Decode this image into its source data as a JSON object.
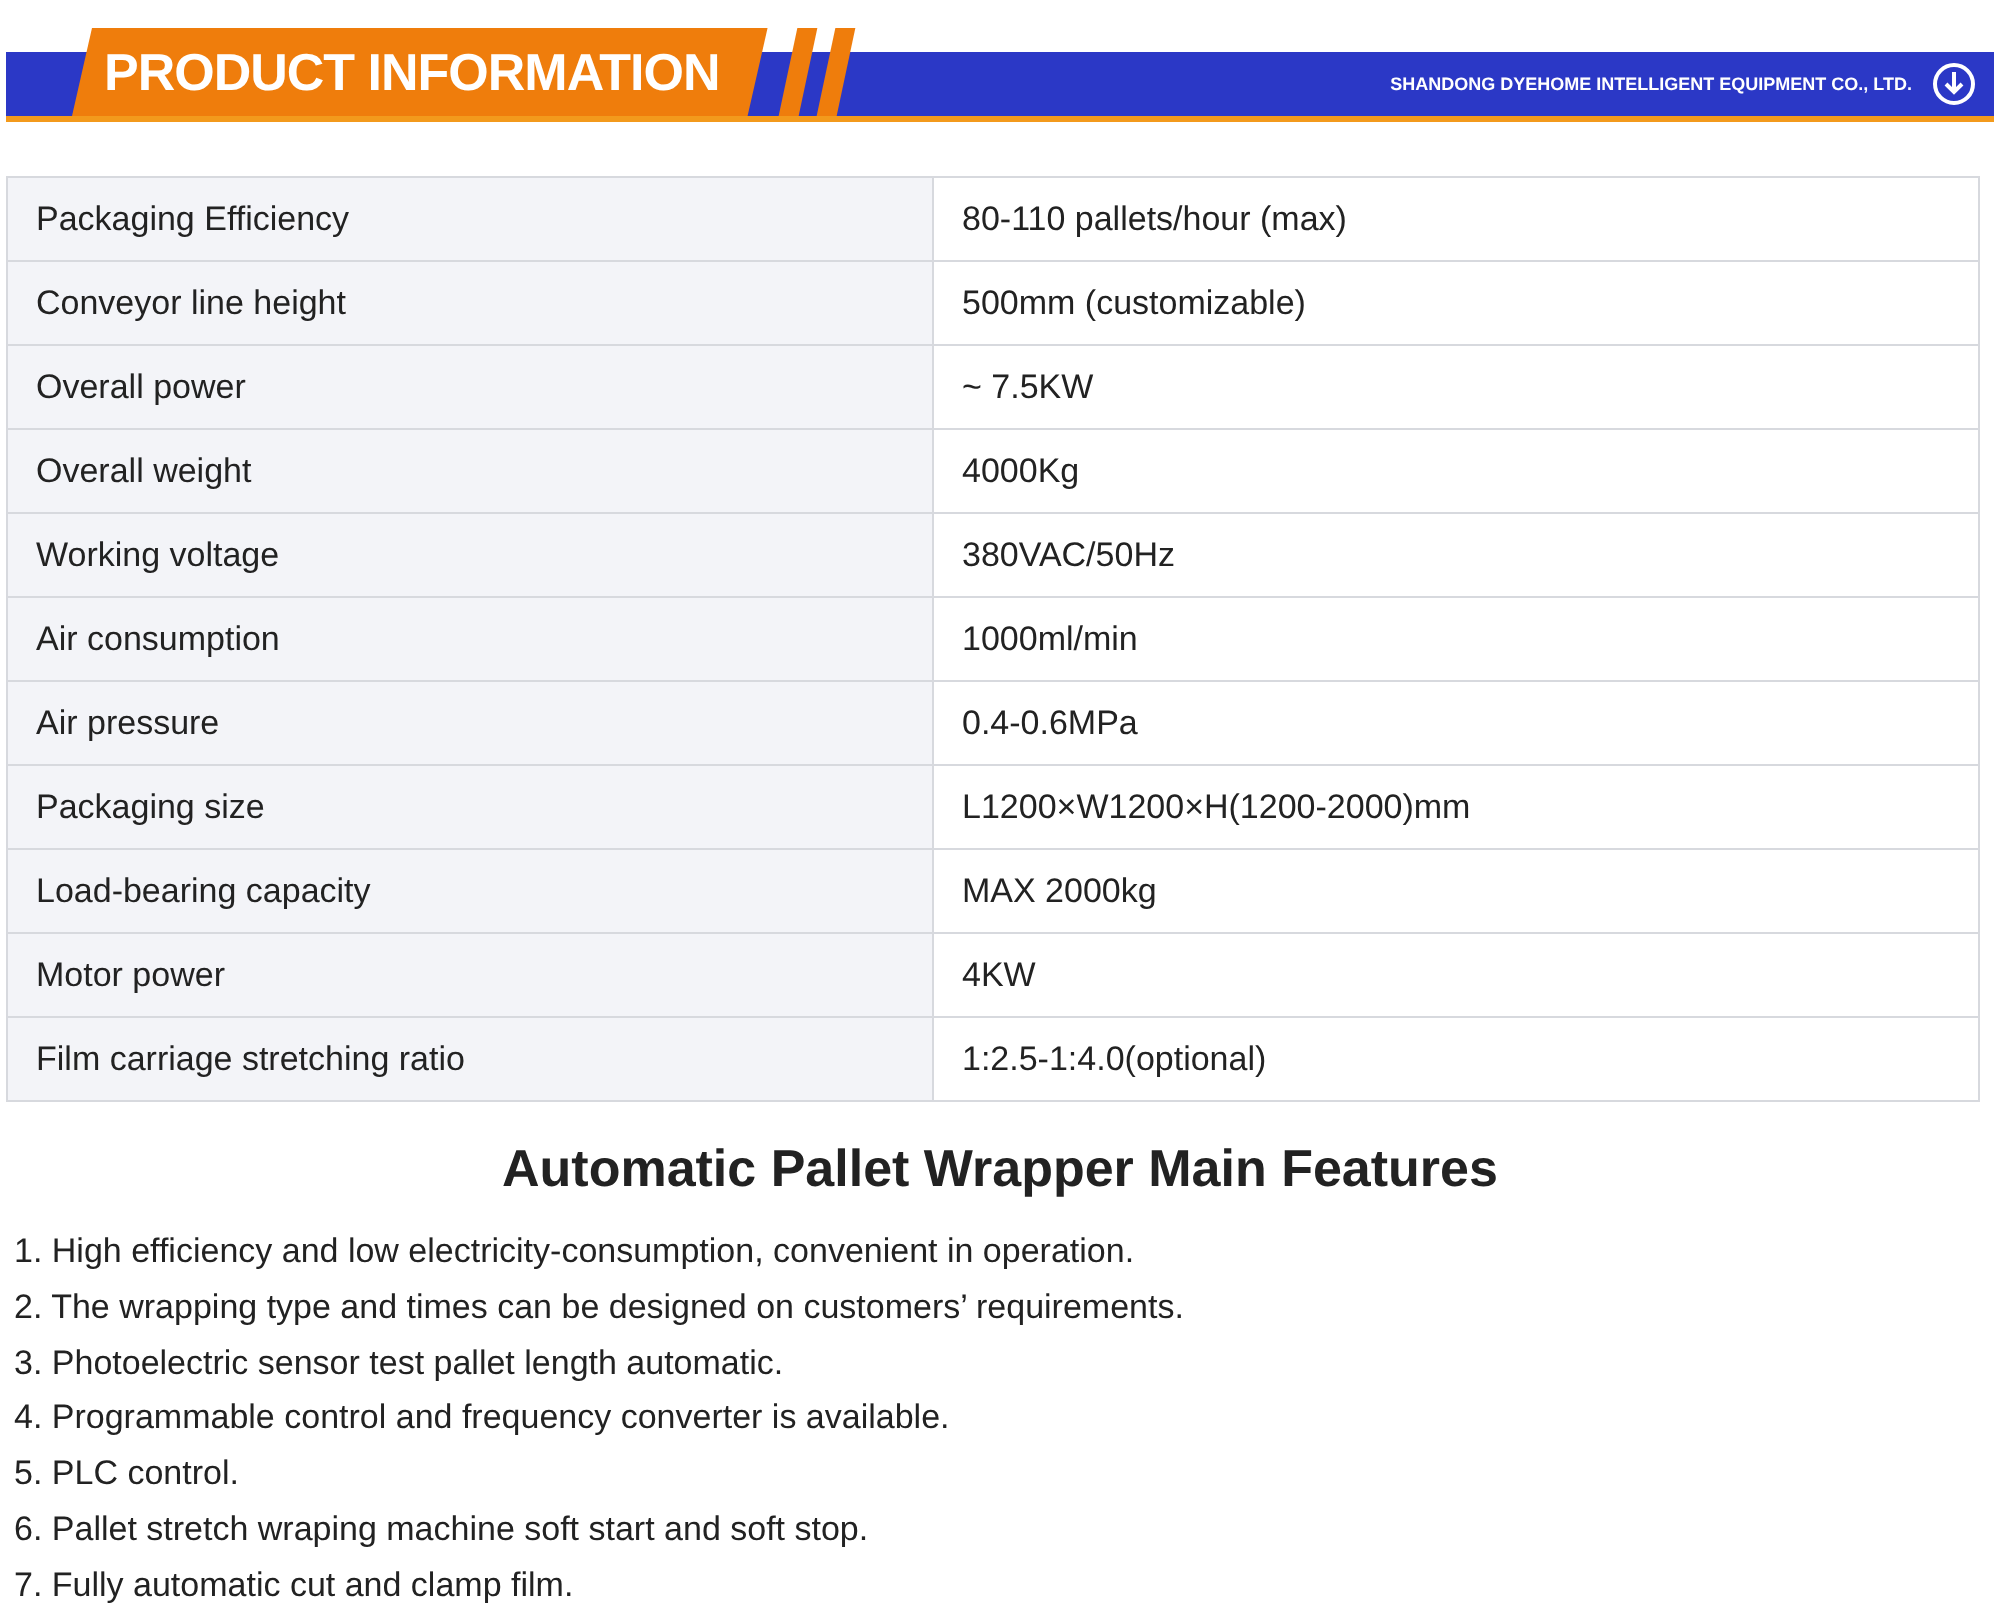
{
  "banner": {
    "title": "PRODUCT INFORMATION",
    "company": "SHANDONG DYEHOME INTELLIGENT EQUIPMENT CO., LTD."
  },
  "specs": [
    {
      "label": "Packaging Efficiency",
      "value": "80-110 pallets/hour (max)"
    },
    {
      "label": "Conveyor line height",
      "value": "500mm (customizable)"
    },
    {
      "label": "Overall power",
      "value": "~ 7.5KW"
    },
    {
      "label": "Overall weight",
      "value": "4000Kg"
    },
    {
      "label": "Working voltage",
      "value": "380VAC/50Hz"
    },
    {
      "label": "Air consumption",
      "value": "1000ml/min"
    },
    {
      "label": "Air pressure",
      "value": "0.4-0.6MPa"
    },
    {
      "label": "Packaging size",
      "value": "L1200×W1200×H(1200-2000)mm"
    },
    {
      "label": "Load-bearing capacity",
      "value": "MAX 2000kg"
    },
    {
      "label": "Motor power",
      "value": "4KW"
    },
    {
      "label": "Film carriage stretching ratio",
      "value": "1:2.5-1:4.0(optional)"
    }
  ],
  "features": {
    "heading": "Automatic Pallet Wrapper Main Features",
    "items": [
      "1. High efficiency and low electricity-consumption, convenient in operation.",
      "2. The wrapping type and times can be designed on customers’ requirements.",
      "3. Photoelectric sensor test pallet length automatic.",
      "4. Programmable control and frequency converter is available.",
      "5. PLC control.",
      "6. Pallet stretch wraping machine soft start and soft stop.",
      "7. Fully automatic cut and clamp film."
    ]
  }
}
